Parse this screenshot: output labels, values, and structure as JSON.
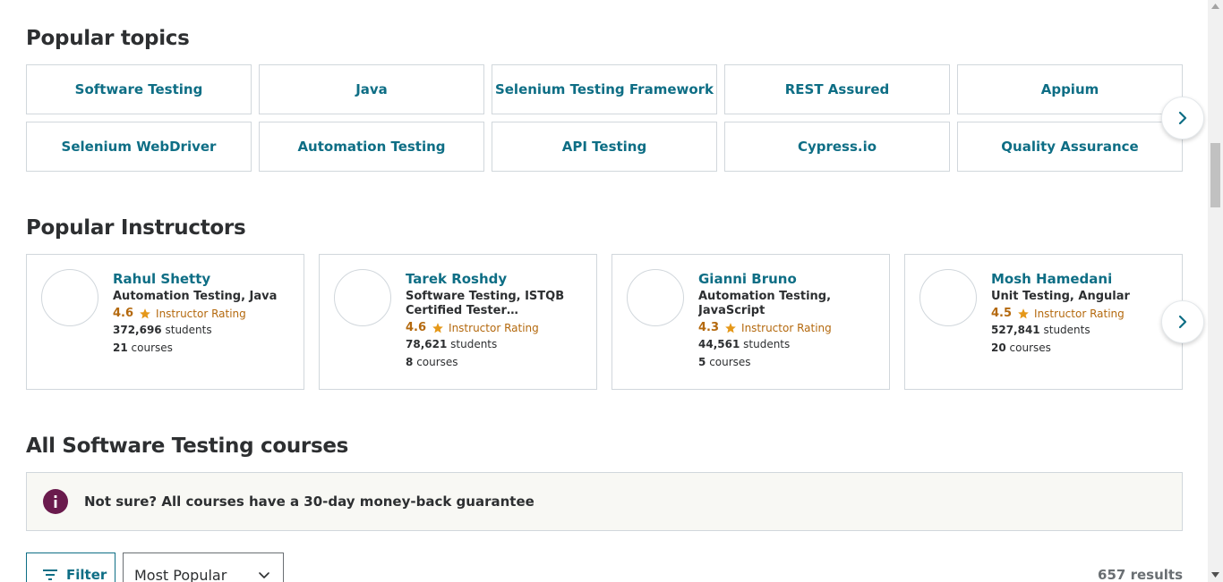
{
  "popular_topics": {
    "title": "Popular topics",
    "rows": [
      [
        "Software Testing",
        "Java",
        "Selenium Testing Framework",
        "REST Assured",
        "Appium"
      ],
      [
        "Selenium WebDriver",
        "Automation Testing",
        "API Testing",
        "Cypress.io",
        "Quality Assurance"
      ]
    ],
    "next_icon": "chevron-right-icon"
  },
  "popular_instructors": {
    "title": "Popular Instructors",
    "rating_label": "Instructor Rating",
    "students_label": "students",
    "courses_label": "courses",
    "items": [
      {
        "name": "Rahul Shetty",
        "topics": "Automation Testing, Java",
        "rating": "4.6",
        "students": "372,696",
        "courses": "21"
      },
      {
        "name": "Tarek Roshdy",
        "topics": "Software Testing, ISTQB Certified Tester Foundation Level",
        "rating": "4.6",
        "students": "78,621",
        "courses": "8"
      },
      {
        "name": "Gianni Bruno",
        "topics": "Automation Testing, JavaScript",
        "rating": "4.3",
        "students": "44,561",
        "courses": "5"
      },
      {
        "name": "Mosh Hamedani",
        "topics": "Unit Testing, Angular",
        "rating": "4.5",
        "students": "527,841",
        "courses": "20"
      }
    ],
    "next_icon": "chevron-right-icon"
  },
  "all_courses": {
    "title": "All Software Testing courses",
    "banner_text": "Not sure? All courses have a 30-day money-back guarantee",
    "filter_label": "Filter",
    "sort_value": "Most Popular",
    "results": "657 results"
  },
  "colors": {
    "link_teal": "#0e6e85",
    "rating_orange": "#b4690e",
    "info_purple": "#6a1b4d",
    "border": "#d1d7dc"
  }
}
